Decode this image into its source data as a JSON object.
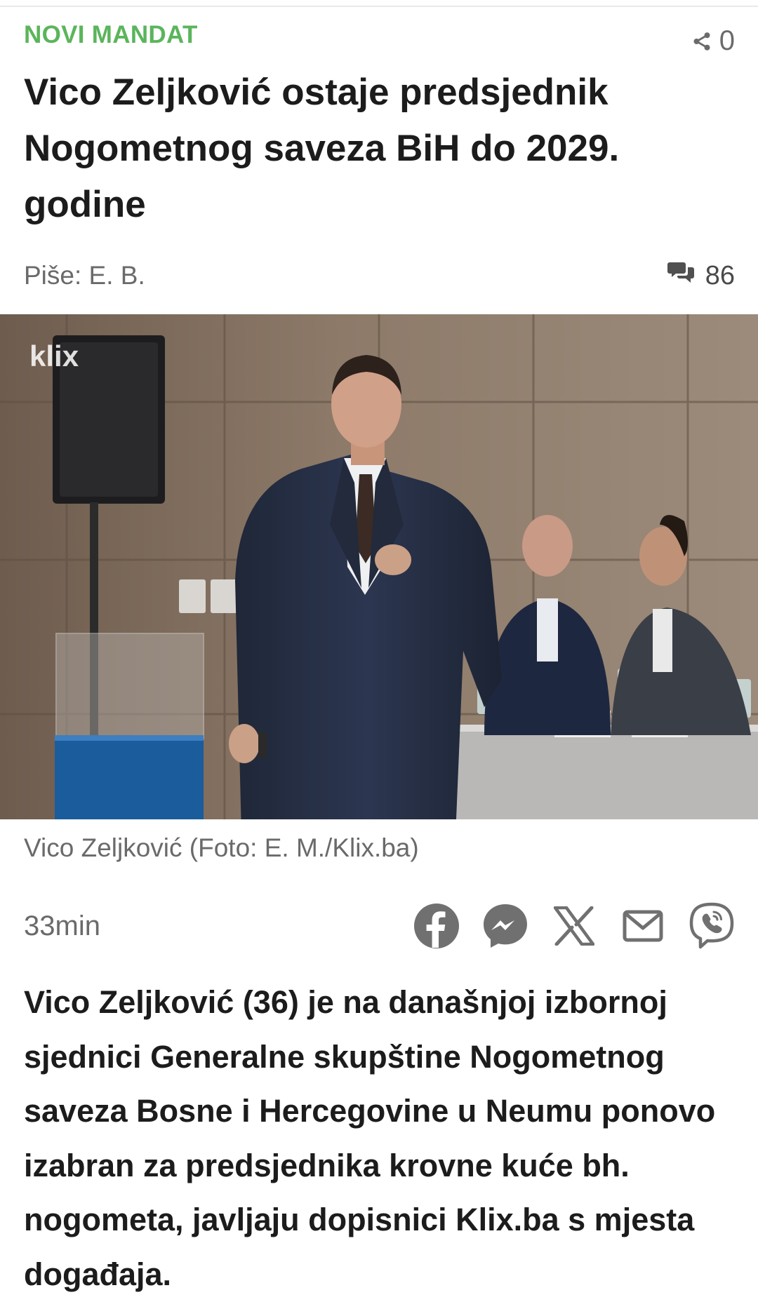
{
  "article": {
    "kicker": "NOVI MANDAT",
    "share_count": "0",
    "headline": "Vico Zeljković ostaje predsjednik Nogometnog saveza BiH do 2029. godine",
    "author": "Piše: E. B.",
    "comment_count": "86",
    "image_watermark": "klix",
    "image_caption": "Vico Zeljković (Foto: E. M./Klix.ba)",
    "time_ago": "33min",
    "lead": "Vico Zeljković (36) je na današnjoj izbornoj sjednici Generalne skupštine Nogometnog saveza Bosne i Hercegovine u Neumu ponovo izabran za predsjednika krovne kuće bh. nogometa, javljaju dopisnici Klix.ba s mjesta događaja."
  },
  "icons": {
    "share": "share-icon",
    "comments": "comments-icon",
    "facebook": "facebook-icon",
    "messenger": "messenger-icon",
    "x": "x-icon",
    "email": "email-icon",
    "viber": "viber-icon"
  },
  "colors": {
    "kicker": "#5bb55b",
    "text": "#1c1c1c",
    "muted": "#6a6a6a",
    "icon": "#707070"
  }
}
